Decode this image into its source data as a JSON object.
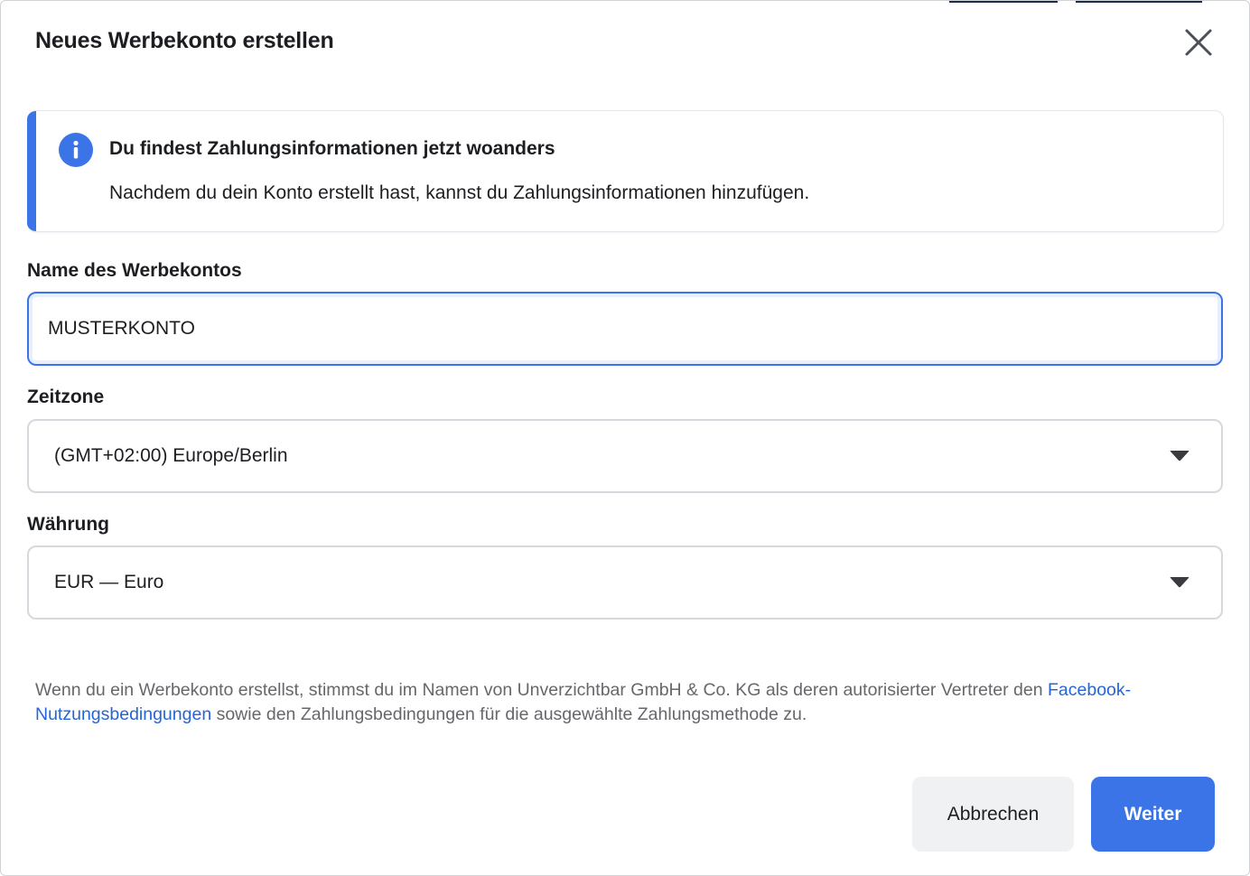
{
  "dialog": {
    "title": "Neues Werbekonto erstellen",
    "close_icon": "close-icon"
  },
  "notice": {
    "icon": "info-icon",
    "heading": "Du findest Zahlungsinformationen jetzt woanders",
    "body": "Nachdem du dein Konto erstellt hast, kannst du Zahlungsinformationen hinzufügen."
  },
  "fields": {
    "account_name": {
      "label": "Name des Werbekontos",
      "value": "MUSTERKONTO"
    },
    "timezone": {
      "label": "Zeitzone",
      "value": "(GMT+02:00) Europe/Berlin"
    },
    "currency": {
      "label": "Währung",
      "value": "EUR — Euro"
    }
  },
  "legal": {
    "text_before": "Wenn du ein Werbekonto erstellst, stimmst du im Namen von Unverzichtbar GmbH & Co. KG als deren autorisierter Vertreter den ",
    "link": "Facebook-Nutzungsbedingungen",
    "text_after": " sowie den Zahlungsbedingungen für die ausgewählte Zahlungsmethode zu."
  },
  "buttons": {
    "cancel": "Abbrechen",
    "next": "Weiter"
  },
  "colors": {
    "accent": "#3b74e6",
    "link": "#2565d6"
  }
}
